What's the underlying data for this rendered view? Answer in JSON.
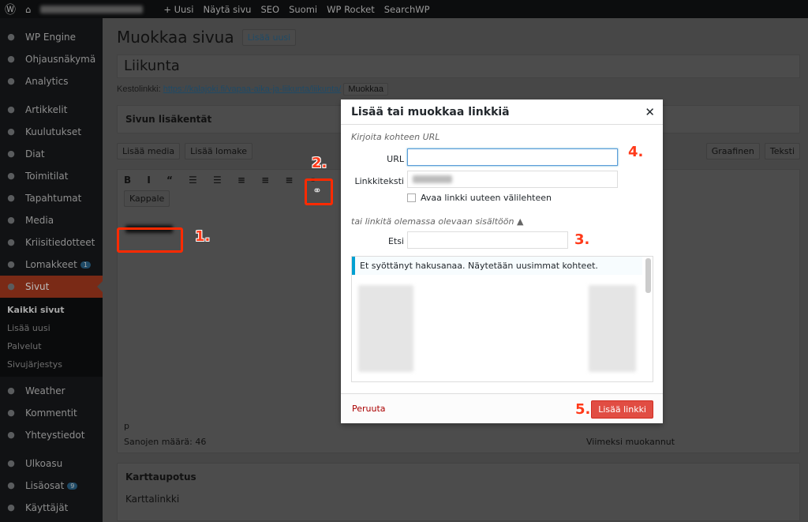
{
  "adminbar": {
    "wp_logo_icon": "wordpress-icon",
    "home_icon": "home-icon",
    "items": [
      "+ Uusi",
      "Näytä sivu",
      "SEO",
      "Suomi",
      "WP Rocket",
      "SearchWP"
    ]
  },
  "sidebar": {
    "items": [
      {
        "label": "WP Engine",
        "icon": "grid-icon"
      },
      {
        "label": "Ohjausnäkymä",
        "icon": "dashboard-icon"
      },
      {
        "label": "Analytics",
        "icon": "analytics-icon"
      },
      {
        "label": "Artikkelit",
        "icon": "pin-icon"
      },
      {
        "label": "Kuulutukset",
        "icon": "pin-icon"
      },
      {
        "label": "Diat",
        "icon": "pin-icon"
      },
      {
        "label": "Toimitilat",
        "icon": "pin-icon"
      },
      {
        "label": "Tapahtumat",
        "icon": "pin-icon"
      },
      {
        "label": "Media",
        "icon": "media-icon"
      },
      {
        "label": "Kriisitiedotteet",
        "icon": "shield-icon"
      },
      {
        "label": "Lomakkeet",
        "icon": "form-icon",
        "badge": "1"
      },
      {
        "label": "Sivut",
        "icon": "page-icon"
      }
    ],
    "sub": [
      "Kaikki sivut",
      "Lisää uusi",
      "Palvelut",
      "Sivujärjestys"
    ],
    "items2": [
      {
        "label": "Weather",
        "icon": "cloud-icon"
      },
      {
        "label": "Kommentit",
        "icon": "comment-icon"
      },
      {
        "label": "Yhteystiedot",
        "icon": "people-icon"
      }
    ],
    "items3": [
      {
        "label": "Ulkoasu",
        "icon": "brush-icon"
      },
      {
        "label": "Lisäosat",
        "icon": "plugin-icon",
        "badge": "9"
      },
      {
        "label": "Käyttäjät",
        "icon": "user-icon"
      }
    ]
  },
  "main": {
    "title": "Muokkaa sivua",
    "add_new": "Lisää uusi",
    "post_title": "Liikunta",
    "permalink_label": "Kestolinkki:",
    "permalink": "https://kalajoki.fi/vapaa-aika-ja-liikunta/liikunta/",
    "edit": "Muokkaa",
    "box1": "Sivun lisäkentät",
    "add_media": "Lisää media",
    "add_form": "Lisää lomake",
    "tab_visual": "Graafinen",
    "tab_text": "Teksti",
    "format": "Kappale",
    "path": "p",
    "word_count": "Sanojen määrä: 46",
    "last_edited": "Viimeksi muokannut",
    "box2": "Karttaupotus",
    "map_link": "Karttalinkki"
  },
  "modal": {
    "title": "Lisää tai muokkaa linkkiä",
    "url_heading": "Kirjoita kohteen URL",
    "url_label": "URL",
    "url_value": "",
    "text_label": "Linkkiteksti",
    "new_tab": "Avaa linkki uuteen välilehteen",
    "existing": "tai linkitä olemassa olevaan sisältöön ▲",
    "search_label": "Etsi",
    "search_value": "",
    "notice": "Et syöttänyt hakusanaa. Näytetään uusimmat kohteet.",
    "cancel": "Peruuta",
    "submit": "Lisää linkki"
  },
  "annotations": [
    "1.",
    "2.",
    "3.",
    "4.",
    "5."
  ],
  "colors": {
    "highlight": "#ff2a00",
    "primary_button": "#e14d43",
    "active_menu": "#d54e21"
  }
}
